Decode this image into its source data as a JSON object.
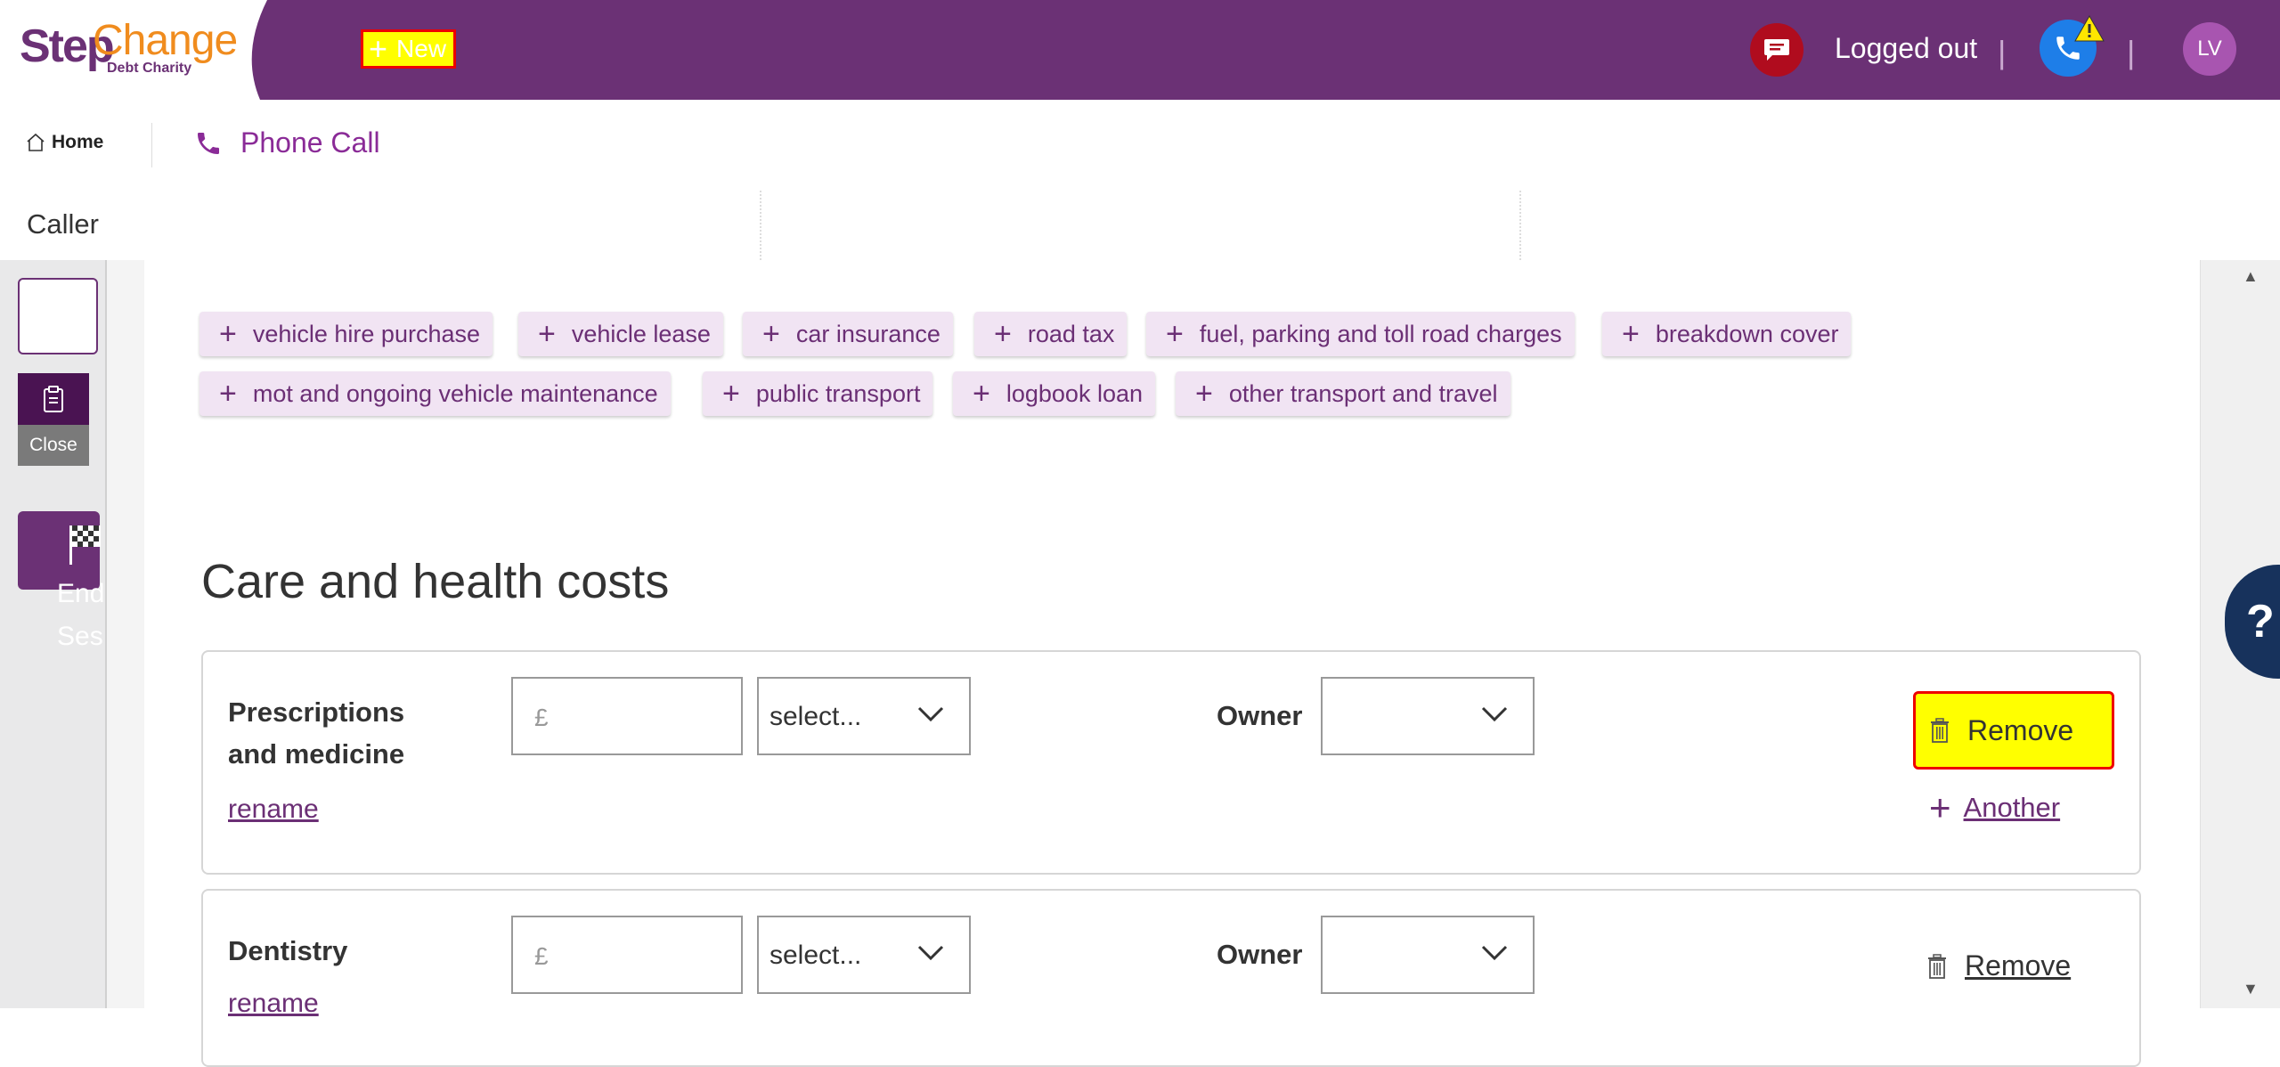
{
  "header": {
    "logo_step": "Step",
    "logo_change": "Change",
    "logo_sub": "Debt Charity",
    "new_label": "New",
    "status": "Logged out",
    "separator": "|",
    "avatar_initials": "LV"
  },
  "nav": {
    "home": "Home",
    "phone_call": "Phone Call"
  },
  "caller": {
    "label": "Caller"
  },
  "sidebar": {
    "close_label": "Close",
    "end_session_line1": "End",
    "end_session_line2": "Ses"
  },
  "chips": [
    {
      "label": "vehicle hire purchase"
    },
    {
      "label": "vehicle lease"
    },
    {
      "label": "car insurance"
    },
    {
      "label": "road tax"
    },
    {
      "label": "fuel, parking and toll road charges"
    },
    {
      "label": "breakdown cover"
    },
    {
      "label": "mot and ongoing vehicle maintenance"
    },
    {
      "label": "public transport"
    },
    {
      "label": "logbook loan"
    },
    {
      "label": "other transport and travel"
    }
  ],
  "section": {
    "title": "Care and health costs"
  },
  "items": [
    {
      "label_line1": "Prescriptions",
      "label_line2": "and medicine",
      "rename": "rename",
      "currency_placeholder": "£",
      "frequency": "select...",
      "owner_label": "Owner",
      "owner_value": "",
      "remove": "Remove",
      "another": "Another"
    },
    {
      "label_line1": "Dentistry",
      "rename": "rename",
      "currency_placeholder": "£",
      "frequency": "select...",
      "owner_label": "Owner",
      "owner_value": "",
      "remove": "Remove"
    }
  ],
  "help": {
    "label": "?"
  },
  "colors": {
    "brand_purple": "#6b3175",
    "brand_orange": "#f08c1e",
    "highlight_yellow": "#ffff00",
    "highlight_border": "#ee0000",
    "chip_bg": "#f1e4f3",
    "chat_red": "#b00c1e",
    "phone_blue": "#1e7ee8",
    "help_navy": "#17325c"
  },
  "icons": [
    "plus-icon",
    "chat-icon",
    "phone-icon",
    "warning-icon",
    "home-icon",
    "clipboard-icon",
    "flag-icon",
    "trash-icon",
    "chevron-down-icon",
    "help-icon"
  ]
}
